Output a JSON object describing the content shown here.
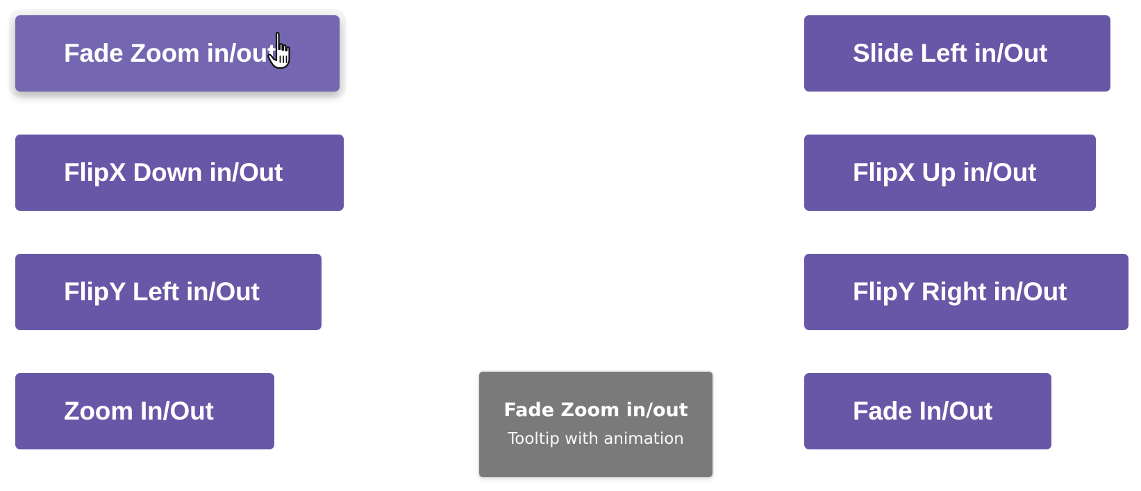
{
  "buttons": {
    "fade_zoom": "Fade Zoom in/out",
    "slide_left": "Slide Left in/Out",
    "flipx_down": "FlipX Down in/Out",
    "flipx_up": "FlipX Up in/Out",
    "flipy_left": "FlipY Left in/Out",
    "flipy_right": "FlipY Right in/Out",
    "zoom": "Zoom In/Out",
    "fade": "Fade In/Out"
  },
  "tooltip": {
    "title": "Fade Zoom in/out",
    "subtitle": "Tooltip with animation"
  },
  "colors": {
    "button": "#6857a7",
    "button_hover": "#7566b1",
    "tooltip": "#7a7a7a"
  },
  "icons": {
    "cursor": "hand-pointer-icon"
  }
}
